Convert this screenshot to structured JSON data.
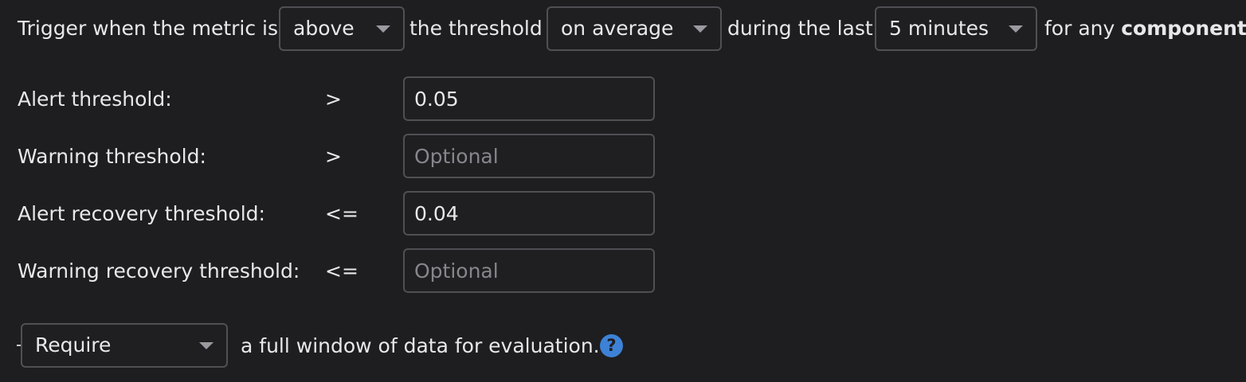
{
  "trigger": {
    "prefix": "Trigger when the metric is",
    "comparison_value": "above",
    "mid1": "the threshold",
    "aggregation_value": "on average",
    "mid2": "during the last",
    "window_value": "5 minutes",
    "suffix_plain": "for any",
    "suffix_bold": "component"
  },
  "thresholds": [
    {
      "label": "Alert threshold:",
      "operator": ">",
      "value": "0.05",
      "placeholder": ""
    },
    {
      "label": "Warning threshold:",
      "operator": ">",
      "value": "",
      "placeholder": "Optional"
    },
    {
      "label": "Alert recovery threshold:",
      "operator": "<=",
      "value": "0.04",
      "placeholder": ""
    },
    {
      "label": "Warning recovery threshold:",
      "operator": "<=",
      "value": "",
      "placeholder": "Optional"
    }
  ],
  "data_window": {
    "select_value": "Require",
    "text": "a full window of data for evaluation.",
    "help_glyph": "?",
    "help_icon": "question-circle-icon",
    "help_color": "#3d82d6"
  }
}
